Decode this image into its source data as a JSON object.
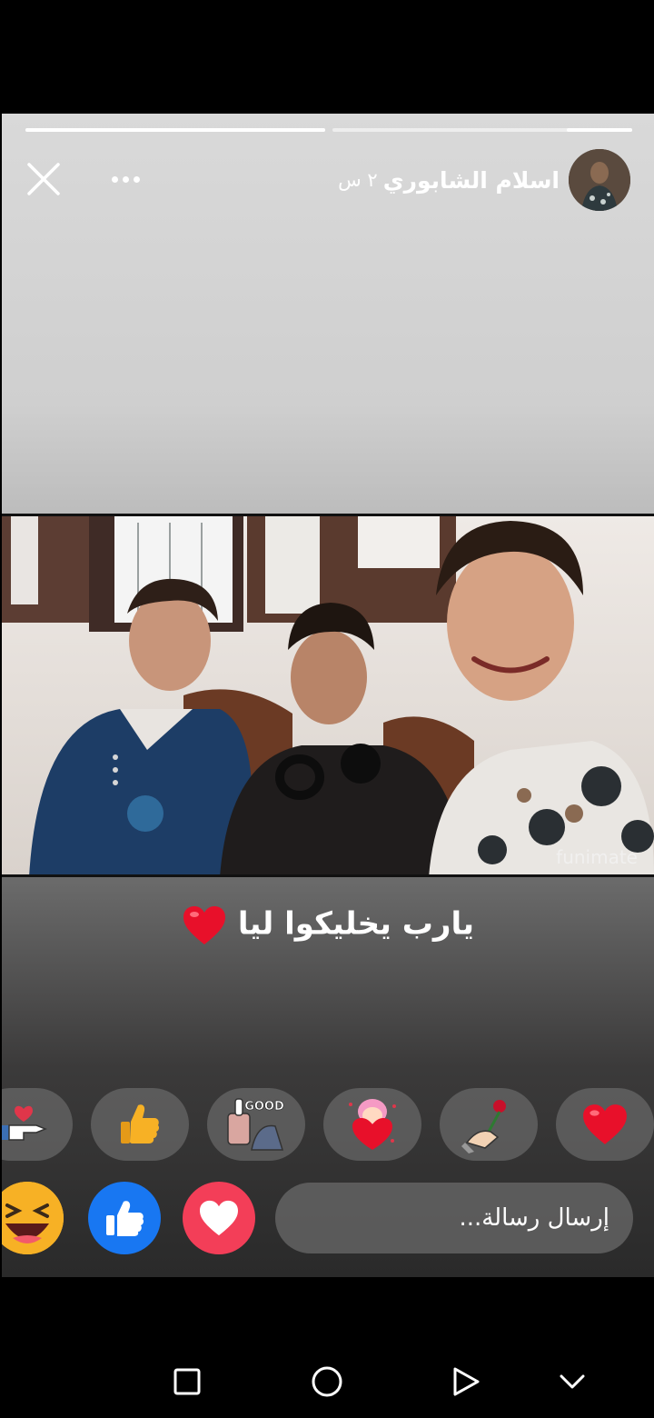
{
  "story": {
    "progress_segments": [
      1.0,
      0.15
    ],
    "author_name": "اسلام الشابوري",
    "time": "٢ س",
    "caption": "يارب يخليكوا ليا",
    "watermark": "funimate"
  },
  "stickers": [
    {
      "name": "pointing-hand-heart-sticker"
    },
    {
      "name": "thumbs-up-emoji-sticker"
    },
    {
      "name": "good-sticker",
      "text": "GOOD"
    },
    {
      "name": "girl-holding-heart-sticker"
    },
    {
      "name": "hand-with-rose-sticker"
    },
    {
      "name": "red-heart-sticker"
    }
  ],
  "reactions": [
    {
      "name": "haha-reaction",
      "color": "#F7B125"
    },
    {
      "name": "like-reaction",
      "color": "#1877F2"
    },
    {
      "name": "love-reaction",
      "color": "#F33E58"
    }
  ],
  "message_input": {
    "placeholder": "إرسال رسالة..."
  },
  "colors": {
    "like": "#1877F2",
    "love": "#F33E58",
    "haha": "#F7B125",
    "heart": "#E8102A"
  }
}
